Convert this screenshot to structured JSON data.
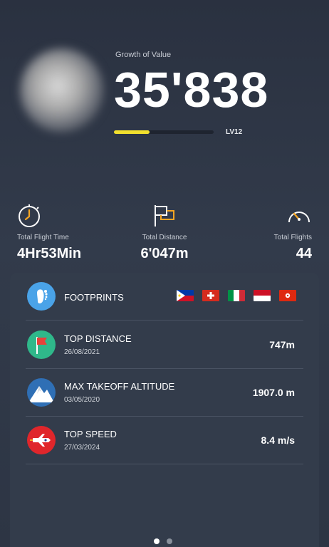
{
  "header": {
    "growth_label": "Growth of Value",
    "growth_value": "35'838",
    "level_label": "LV12",
    "level_progress": 0.36
  },
  "stats": [
    {
      "label": "Total Flight Time",
      "value": "4Hr53Min",
      "icon": "stopwatch-icon"
    },
    {
      "label": "Total Distance",
      "value": "6'047m",
      "icon": "flag-icon"
    },
    {
      "label": "Total Flights",
      "value": "44",
      "icon": "speedometer-icon"
    }
  ],
  "records": {
    "footprints": {
      "title": "FOOTPRINTS",
      "icon": "footprint-icon",
      "flags": [
        "philippines",
        "switzerland",
        "italy",
        "indonesia",
        "hong-kong"
      ]
    },
    "top_distance": {
      "title": "TOP DISTANCE",
      "date": "26/08/2021",
      "value": "747m",
      "icon": "distance-flag-icon"
    },
    "max_altitude": {
      "title": "MAX TAKEOFF ALTITUDE",
      "date": "03/05/2020",
      "value": "1907.0 m",
      "icon": "mountain-icon"
    },
    "top_speed": {
      "title": "TOP SPEED",
      "date": "27/03/2024",
      "value": "8.4 m/s",
      "icon": "speed-icon"
    }
  },
  "pager": {
    "pages": 2,
    "active": 0
  },
  "colors": {
    "accent_yellow": "#f2e02e",
    "icon_orange": "#f5a623",
    "panel": "#333c4b"
  }
}
